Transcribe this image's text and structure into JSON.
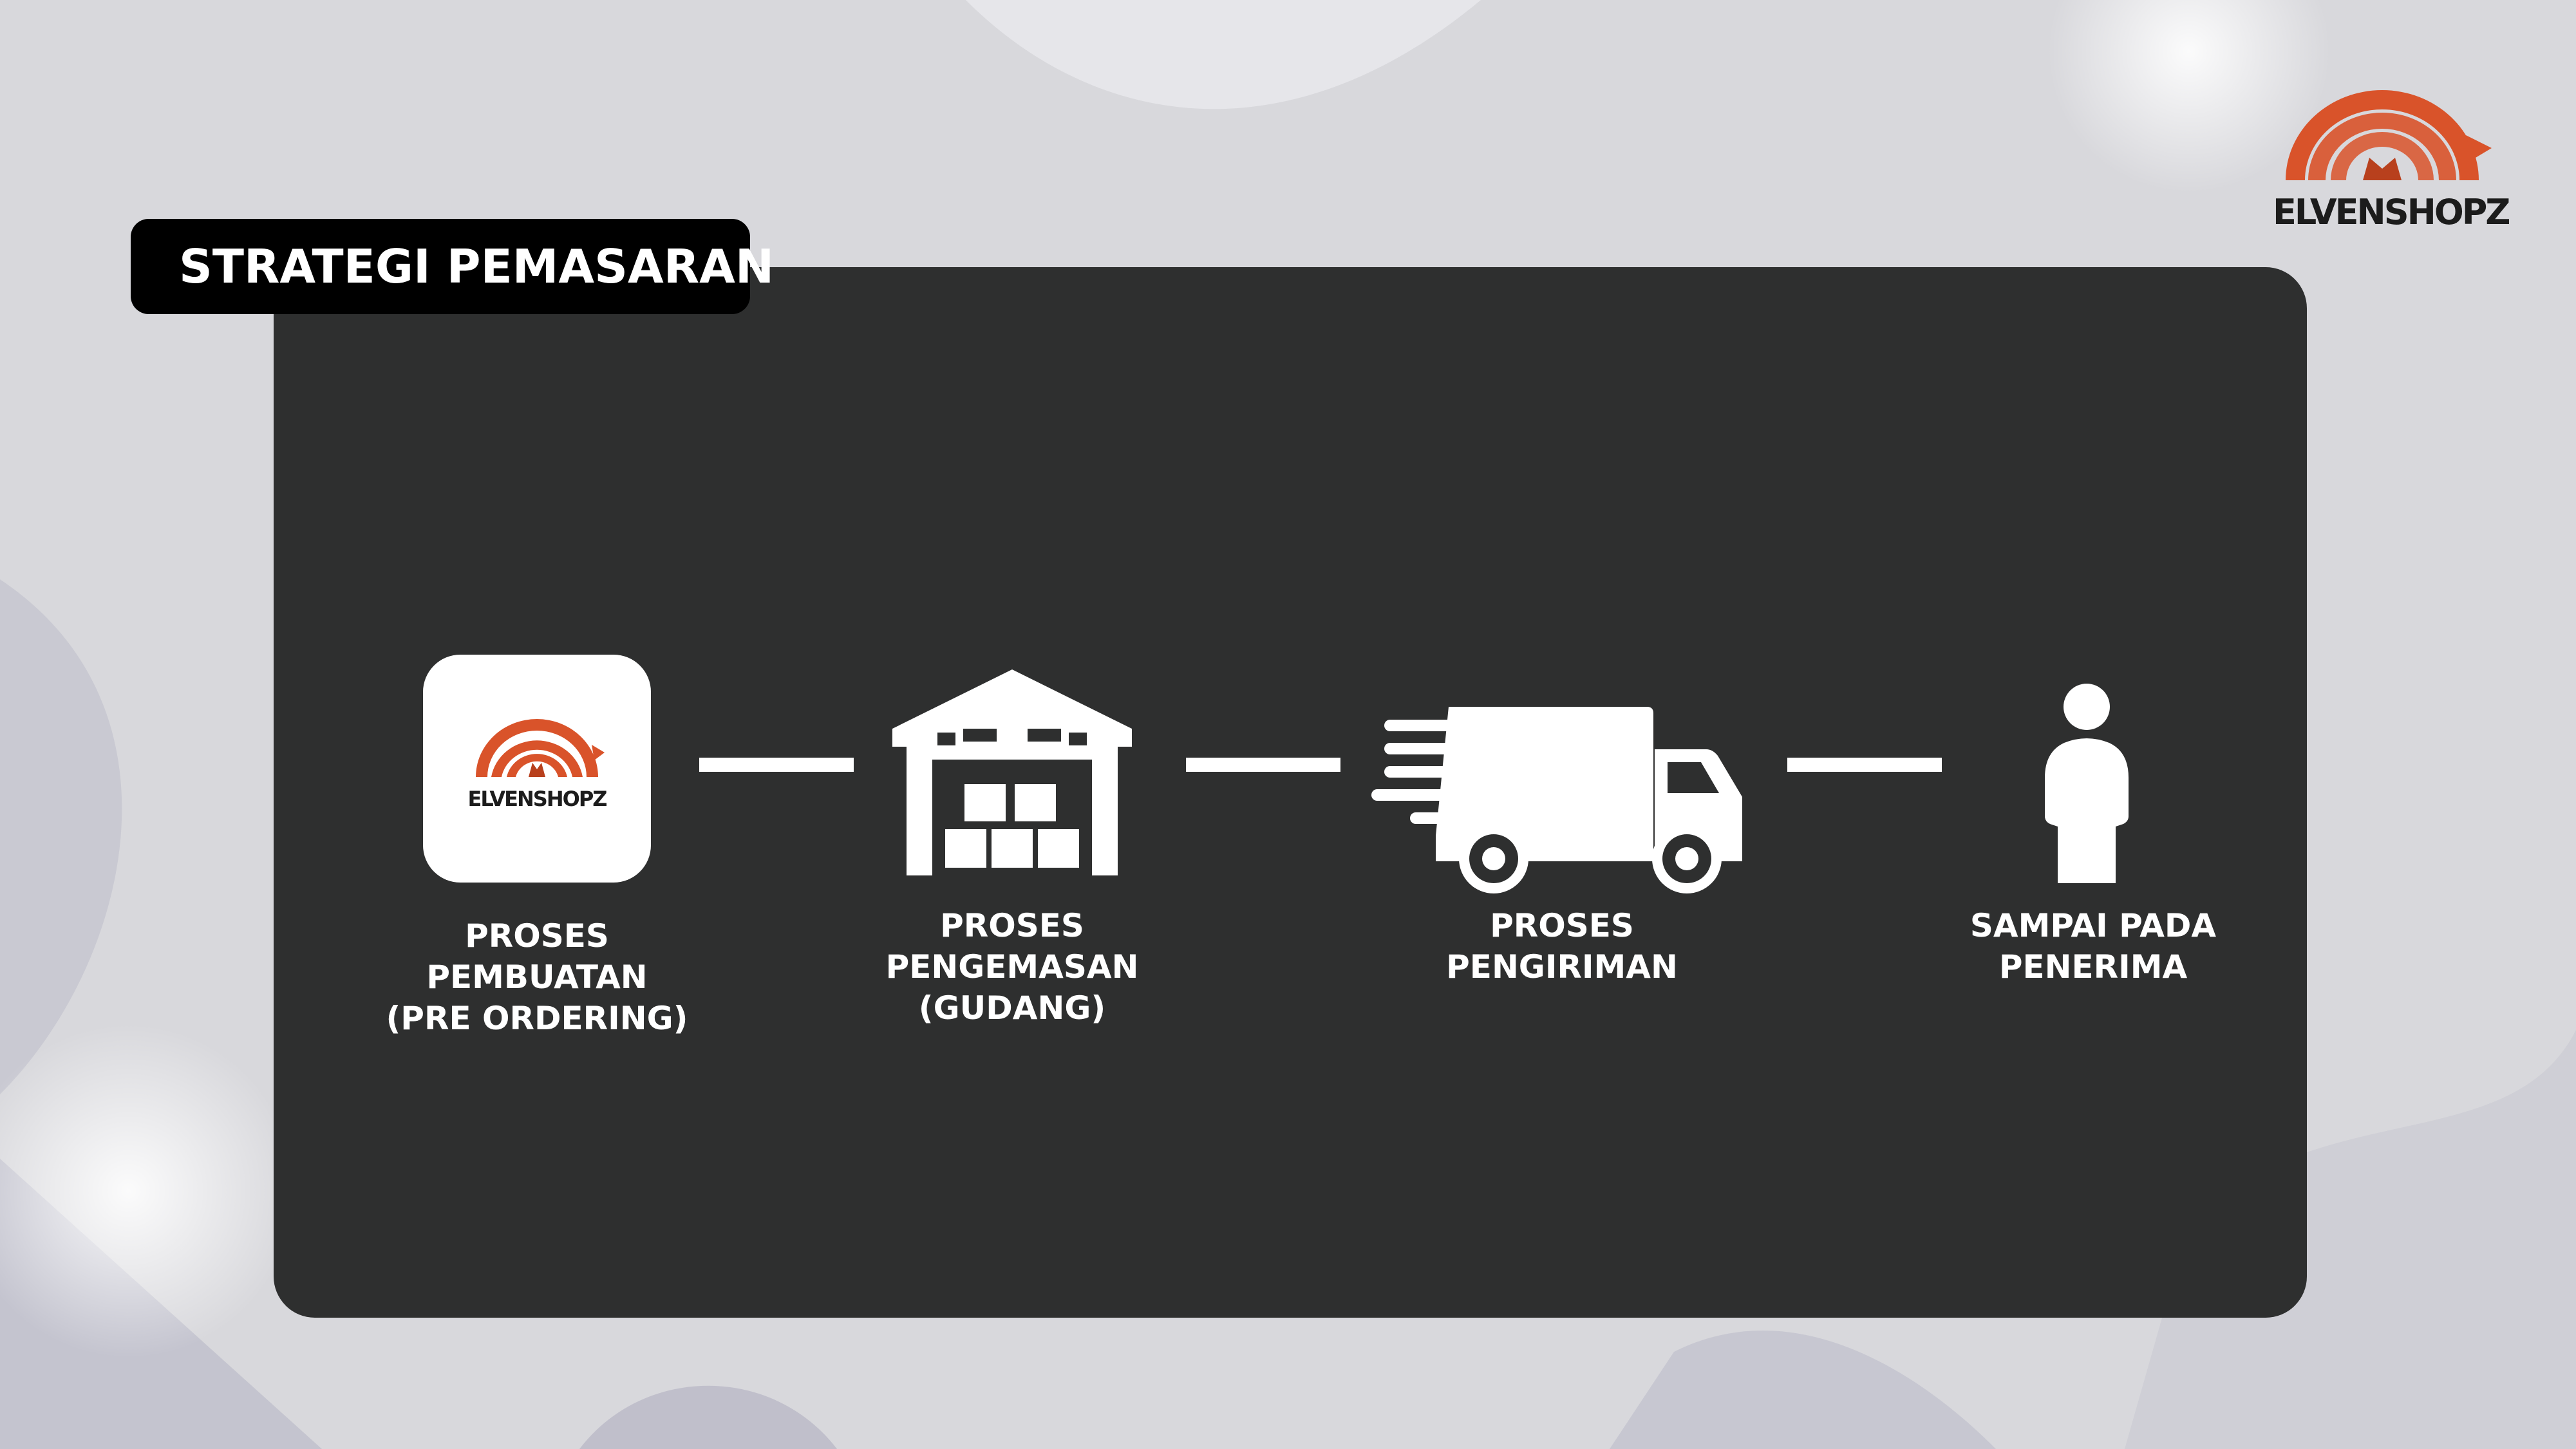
{
  "header": {
    "title": "STRATEGI PEMASARAN"
  },
  "brand": {
    "name": "ELVENSHOPZ",
    "logo_icon": "nine-tailed-fox-icon",
    "logo_color": "#d9532a"
  },
  "colors": {
    "panel": "#2e2f2f",
    "title_bg": "#000000",
    "foreground": "#ffffff"
  },
  "steps": [
    {
      "icon": "elvenshopz-logo-tile",
      "label_lines": [
        "PROSES",
        "PEMBUATAN",
        "(PRE ORDERING)"
      ]
    },
    {
      "icon": "warehouse-icon",
      "label_lines": [
        "PROSES",
        "PENGEMASAN",
        "(GUDANG)"
      ]
    },
    {
      "icon": "delivery-truck-icon",
      "label_lines": [
        "PROSES",
        "PENGIRIMAN"
      ]
    },
    {
      "icon": "person-icon",
      "label_lines": [
        "SAMPAI PADA",
        "PENERIMA"
      ]
    }
  ]
}
